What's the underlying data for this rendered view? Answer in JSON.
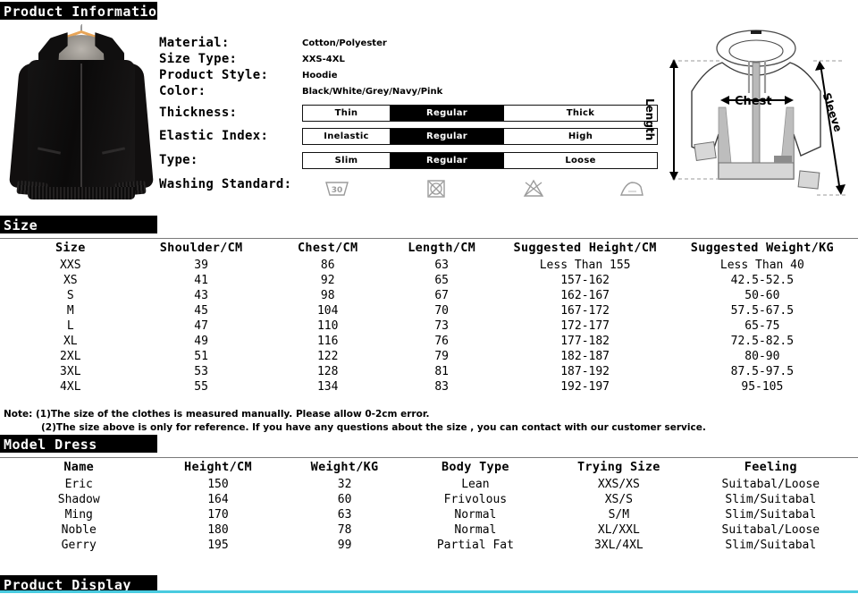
{
  "sections": {
    "product_information": "Product Information",
    "size": "Size",
    "model_dress": "Model Dress",
    "product_display": "Product Display"
  },
  "colors": {
    "header_bar_bg": "#000000",
    "header_bar_text": "#ffffff",
    "selected_option_bg": "#000000",
    "accent_rule": "#49cbe0"
  },
  "specs": {
    "material": {
      "label": "Material:",
      "value": "Cotton/Polyester"
    },
    "size_type": {
      "label": "Size Type:",
      "value": "XXS-4XL"
    },
    "product_style": {
      "label": "Product Style:",
      "value": "Hoodie"
    },
    "color": {
      "label": "Color:",
      "value": "Black/White/Grey/Navy/Pink"
    },
    "thickness": {
      "label": "Thickness:",
      "options": [
        "Thin",
        "Regular",
        "Thick"
      ],
      "selected": "Regular"
    },
    "elastic_index": {
      "label": "Elastic Index:",
      "options": [
        "Inelastic",
        "Regular",
        "High"
      ],
      "selected": "Regular"
    },
    "type": {
      "label": "Type:",
      "options": [
        "Slim",
        "Regular",
        "Loose"
      ],
      "selected": "Regular"
    },
    "washing_standard": {
      "label": "Washing Standard:",
      "icons": [
        {
          "name": "wash-30-icon",
          "value": "30"
        },
        {
          "name": "do-not-tumble-dry-icon",
          "value": ""
        },
        {
          "name": "do-not-bleach-icon",
          "value": ""
        },
        {
          "name": "iron-icon",
          "value": ""
        }
      ]
    }
  },
  "diagram": {
    "length_label": "Length",
    "chest_label": "Chest",
    "sleeve_label": "Sleeve"
  },
  "size_table": {
    "headers": [
      "Size",
      "Shoulder/CM",
      "Chest/CM",
      "Length/CM",
      "Suggested Height/CM",
      "Suggested Weight/KG"
    ],
    "rows": [
      [
        "XXS",
        "39",
        "86",
        "63",
        "Less Than 155",
        "Less Than 40"
      ],
      [
        "XS",
        "41",
        "92",
        "65",
        "157-162",
        "42.5-52.5"
      ],
      [
        "S",
        "43",
        "98",
        "67",
        "162-167",
        "50-60"
      ],
      [
        "M",
        "45",
        "104",
        "70",
        "167-172",
        "57.5-67.5"
      ],
      [
        "L",
        "47",
        "110",
        "73",
        "172-177",
        "65-75"
      ],
      [
        "XL",
        "49",
        "116",
        "76",
        "177-182",
        "72.5-82.5"
      ],
      [
        "2XL",
        "51",
        "122",
        "79",
        "182-187",
        "80-90"
      ],
      [
        "3XL",
        "53",
        "128",
        "81",
        "187-192",
        "87.5-97.5"
      ],
      [
        "4XL",
        "55",
        "134",
        "83",
        "192-197",
        "95-105"
      ]
    ]
  },
  "size_note": {
    "line1": "Note: (1)The size of the clothes is measured manually. Please allow 0-2cm error.",
    "line2": "(2)The size above is only for reference. If you have any questions about the size , you can contact with our customer service."
  },
  "model_table": {
    "headers": [
      "Name",
      "Height/CM",
      "Weight/KG",
      "Body Type",
      "Trying Size",
      "Feeling"
    ],
    "rows": [
      [
        "Eric",
        "150",
        "32",
        "Lean",
        "XXS/XS",
        "Suitabal/Loose"
      ],
      [
        "Shadow",
        "164",
        "60",
        "Frivolous",
        "XS/S",
        "Slim/Suitabal"
      ],
      [
        "Ming",
        "170",
        "63",
        "Normal",
        "S/M",
        "Slim/Suitabal"
      ],
      [
        "Noble",
        "180",
        "78",
        "Normal",
        "XL/XXL",
        "Suitabal/Loose"
      ],
      [
        "Gerry",
        "195",
        "99",
        "Partial Fat",
        "3XL/4XL",
        "Slim/Suitabal"
      ]
    ]
  }
}
